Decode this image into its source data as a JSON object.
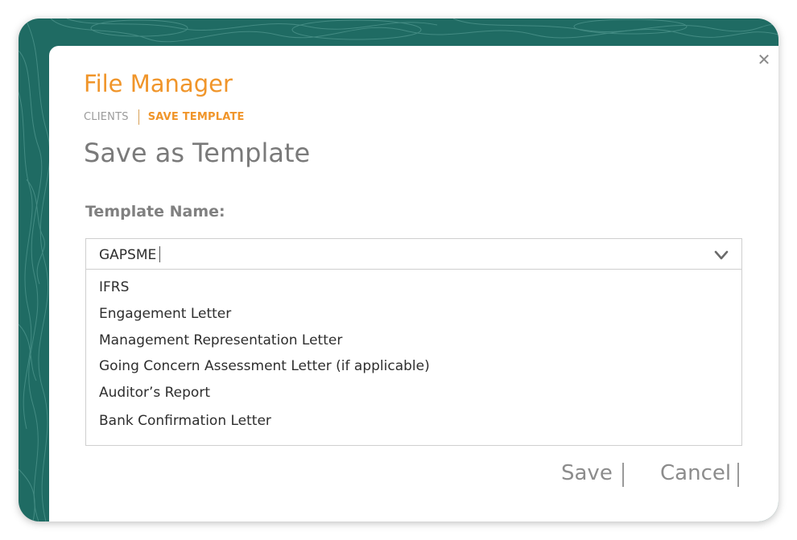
{
  "colors": {
    "accent": "#f0952a",
    "frame": "#1f6b63",
    "panel": "#ffffff",
    "muted_text": "#7a7a7a"
  },
  "window": {
    "close_icon": "close-icon",
    "close_glyph": "✕"
  },
  "header": {
    "app_title": "File Manager",
    "breadcrumb": {
      "items": [
        "CLIENTS",
        "SAVE TEMPLATE"
      ]
    },
    "page_title": "Save as Template"
  },
  "form": {
    "template_name_label": "Template Name:",
    "template_name_value": "GAPSME",
    "dropdown_icon": "chevron-down-icon",
    "options": [
      "IFRS",
      "Engagement Letter",
      "Management Representation Letter",
      "Going Concern Assessment Letter (if applicable)",
      "Auditor’s Report",
      "Bank Confirmation Letter"
    ]
  },
  "actions": {
    "save_label": "Save",
    "cancel_label": "Cancel"
  }
}
